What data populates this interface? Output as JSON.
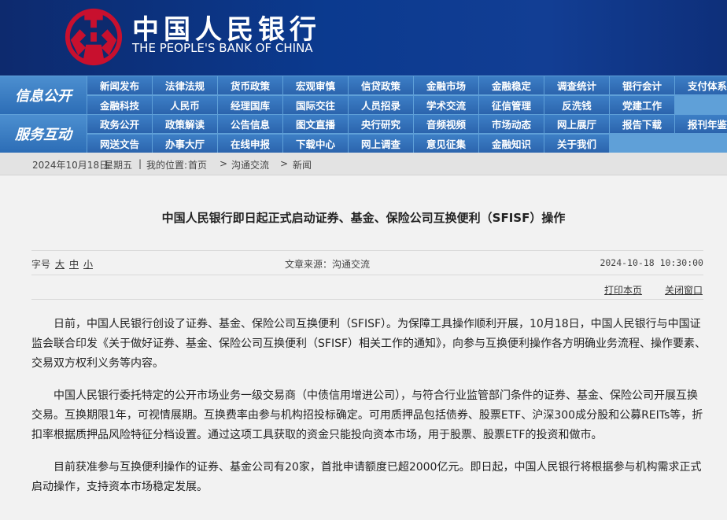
{
  "header": {
    "name_cn": "中国人民银行",
    "name_en": "THE PEOPLE'S BANK OF CHINA"
  },
  "nav": {
    "info_label": "信息公开",
    "service_label": "服务互动",
    "info_row1": [
      "新闻发布",
      "法律法规",
      "货币政策",
      "宏观审慎",
      "信贷政策",
      "金融市场",
      "金融稳定",
      "调查统计",
      "银行会计",
      "支付体系"
    ],
    "info_row2": [
      "金融科技",
      "人民币",
      "经理国库",
      "国际交往",
      "人员招录",
      "学术交流",
      "征信管理",
      "反洗钱",
      "党建工作"
    ],
    "service_row1": [
      "政务公开",
      "政策解读",
      "公告信息",
      "图文直播",
      "央行研究",
      "音频视频",
      "市场动态",
      "网上展厅",
      "报告下载",
      "报刊年鉴"
    ],
    "service_row2": [
      "网送文告",
      "办事大厅",
      "在线申报",
      "下载中心",
      "网上调查",
      "意见征集",
      "金融知识",
      "关于我们"
    ]
  },
  "breadcrumb": {
    "date": "2024年10月18日",
    "weekday": "星期五",
    "sep": "|",
    "location_label": "我的位置:",
    "home": "首页",
    "arrow": ">",
    "section": "沟通交流",
    "current": "新闻"
  },
  "article": {
    "title": "中国人民银行即日起正式启动证券、基金、保险公司互换便利（SFISF）操作",
    "font_size_label": "字号",
    "font_size_large": "大",
    "font_size_medium": "中",
    "font_size_small": "小",
    "source": "文章来源：沟通交流",
    "datetime": "2024-10-18 10:30:00",
    "print_label": "打印本页",
    "close_label": "关闭窗口",
    "paragraphs": [
      "日前，中国人民银行创设了证券、基金、保险公司互换便利（SFISF）。为保障工具操作顺利开展，10月18日，中国人民银行与中国证监会联合印发《关于做好证券、基金、保险公司互换便利（SFISF）相关工作的通知》，向参与互换便利操作各方明确业务流程、操作要素、交易双方权利义务等内容。",
      "中国人民银行委托特定的公开市场业务一级交易商（中债信用增进公司），与符合行业监管部门条件的证券、基金、保险公司开展互换交易。互换期限1年，可视情展期。互换费率由参与机构招投标确定。可用质押品包括债券、股票ETF、沪深300成分股和公募REITs等，折扣率根据质押品风险特征分档设置。通过这项工具获取的资金只能投向资本市场，用于股票、股票ETF的投资和做市。",
      "目前获准参与互换便利操作的证券、基金公司有20家，首批申请额度已超2000亿元。即日起，中国人民银行将根据参与机构需求正式启动操作，支持资本市场稳定发展。"
    ]
  }
}
